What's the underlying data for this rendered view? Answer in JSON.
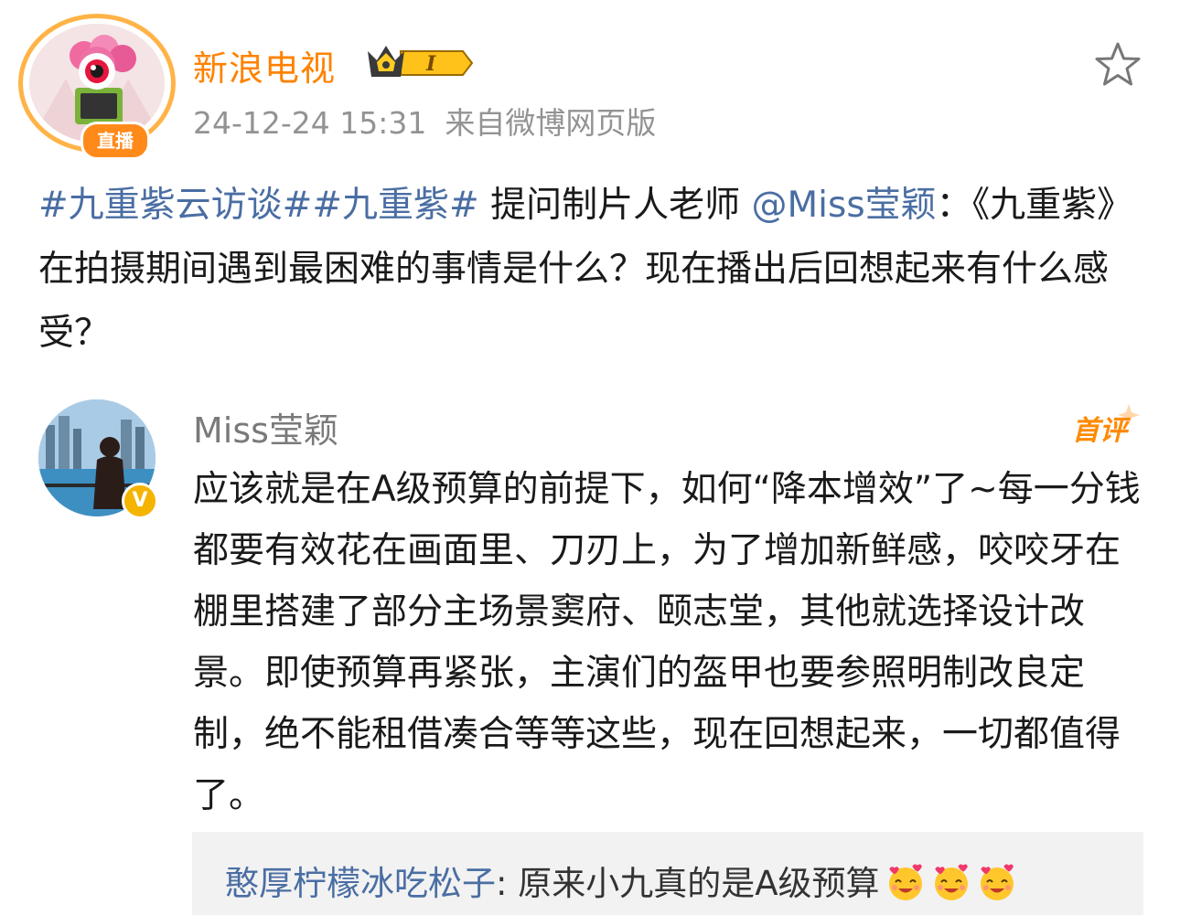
{
  "post": {
    "author": {
      "name": "新浪电视",
      "live_badge": "直播",
      "vip_level": "I"
    },
    "timestamp": "24-12-24 15:31",
    "source": "来自微博网页版",
    "hashtag1": "#九重紫云访谈#",
    "hashtag2": "#九重紫#",
    "text_before_mention": " 提问制片人老师 ",
    "mention": "@Miss莹颖",
    "text_after_mention": "：《九重紫》在拍摄期间遇到最困难的事情是什么？现在播出后回想起来有什么感受？"
  },
  "reply": {
    "author": "Miss莹颖",
    "badge": "首评",
    "text": "应该就是在A级预算的前提下，如何“降本增效”了~每一分钱都要有效花在画面里、刀刃上，为了增加新鲜感，咬咬牙在棚里搭建了部分主场景窦府、颐志堂，其他就选择设计改景。即使预算再紧张，主演们的盔甲也要参照明制改良定制，绝不能租借凑合等等这些，现在回想起来，一切都值得了。"
  },
  "sub_comment": {
    "author": "憨厚柠檬冰吃松子",
    "separator": ": ",
    "text": "原来小九真的是A级预算",
    "emoji_count": 3,
    "emoji_icon": "heart-eyes-emoji"
  },
  "colors": {
    "author_orange": "#ff8200",
    "link_blue": "#4a6ea3",
    "meta_gray": "#939393",
    "sub_comment_bg": "#f2f2f2"
  }
}
